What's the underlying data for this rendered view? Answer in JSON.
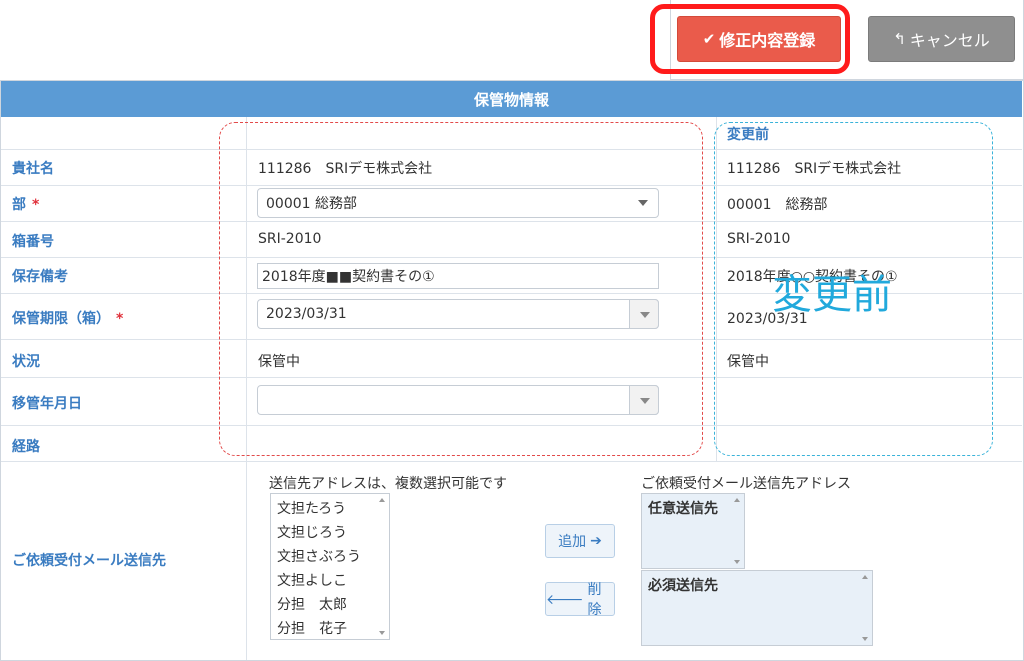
{
  "toolbar": {
    "save_label": "修正内容登録",
    "save_icon": "✔",
    "cancel_label": "キャンセル",
    "cancel_icon": "↰"
  },
  "section": {
    "title": "保管物情報"
  },
  "before_header": "変更前",
  "overlay_text": "変更前",
  "fields": {
    "company": {
      "label": "貴社名",
      "value": "111286　SRIデモ株式会社",
      "before": "111286　SRIデモ株式会社"
    },
    "dept": {
      "label": "部",
      "required": "*",
      "value": "00001 総務部",
      "before": "00001　総務部"
    },
    "box_no": {
      "label": "箱番号",
      "value": "SRI-2010",
      "before": "SRI-2010"
    },
    "note": {
      "label": "保存備考",
      "value": "2018年度■■契約書その①",
      "before": "2018年度○○契約書その①"
    },
    "period": {
      "label": "保管期限（箱）",
      "required": "*",
      "value": "2023/03/31",
      "before": "2023/03/31"
    },
    "status": {
      "label": "状況",
      "value": "保管中",
      "before": "保管中"
    },
    "transfer": {
      "label": "移管年月日",
      "value": ""
    },
    "route": {
      "label": "経路"
    }
  },
  "mail": {
    "label": "ご依頼受付メール送信先",
    "left_caption": "送信先アドレスは、複数選択可能です",
    "right_caption": "ご依頼受付メール送信先アドレス",
    "left_items": [
      "文担たろう",
      "文担じろう",
      "文担さぶろう",
      "文担よしこ",
      "分担　太郎",
      "分担　花子"
    ],
    "add_label": "追加",
    "add_icon": "➔",
    "remove_label": "削除",
    "remove_icon": "🡐",
    "optional_title": "任意送信先",
    "required_title": "必須送信先"
  }
}
